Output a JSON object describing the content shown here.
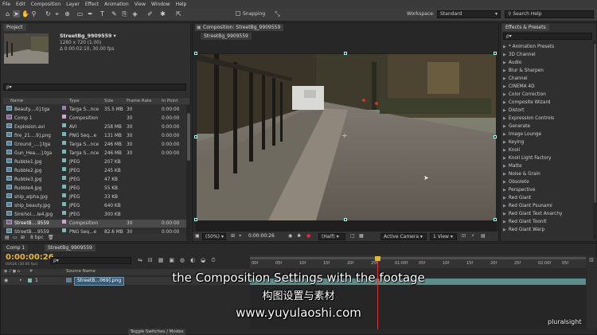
{
  "menu": [
    "File",
    "Edit",
    "Composition",
    "Layer",
    "Effect",
    "Animation",
    "View",
    "Window",
    "Help"
  ],
  "toolbar": {
    "snapping": "Snapping",
    "workspace_label": "Workspace:",
    "workspace_value": "Standard",
    "search_placeholder": "Search Help"
  },
  "project": {
    "tab": "Project",
    "name": "StreetBg_9909559 ▾",
    "line1": "1280 x 720 (1.00)",
    "line2": "Δ 0:00:02:10, 30.00 fps",
    "search": "ρ▾",
    "columns": [
      "Name",
      "Type",
      "Size",
      "Frame Rate",
      "In Point"
    ],
    "rows": [
      {
        "name": "Beauty....0].tga",
        "type": "Targa S...nce",
        "size": "35.5 MB",
        "fps": "30",
        "in": "0:00:00",
        "color": "#9b7fb5",
        "kind": "seq"
      },
      {
        "name": "Comp 1",
        "type": "Composition",
        "size": "",
        "fps": "30",
        "in": "0:00:00",
        "color": "#c9a9c9",
        "kind": "comp"
      },
      {
        "name": "Explosion.avi",
        "type": "AVI",
        "size": "258 MB",
        "fps": "30",
        "in": "0:00:00",
        "color": "#7fb5b5",
        "kind": "avi"
      },
      {
        "name": "fire_21....9].png",
        "type": "PNG Seq...e",
        "size": "131 MB",
        "fps": "30",
        "in": "0:00:00",
        "color": "#7fb5b5",
        "kind": "seq"
      },
      {
        "name": "Ground_....].tga",
        "type": "Targa S...nce",
        "size": "246 MB",
        "fps": "30",
        "in": "0:00:00",
        "color": "#7fb5b5",
        "kind": "seq"
      },
      {
        "name": "Gun_Hea....].tga",
        "type": "Targa S...nce",
        "size": "246 MB",
        "fps": "30",
        "in": "0:00:00",
        "color": "#7fb5b5",
        "kind": "seq"
      },
      {
        "name": "Rubble1.jpg",
        "type": "JPEG",
        "size": "207 KB",
        "fps": "",
        "in": "",
        "color": "#7fb5b5",
        "kind": "img"
      },
      {
        "name": "Rubble2.jpg",
        "type": "JPEG",
        "size": "245 KB",
        "fps": "",
        "in": "",
        "color": "#7fb5b5",
        "kind": "img"
      },
      {
        "name": "Rubble3.jpg",
        "type": "JPEG",
        "size": "47 KB",
        "fps": "",
        "in": "",
        "color": "#7fb5b5",
        "kind": "img"
      },
      {
        "name": "Rubble4.jpg",
        "type": "JPEG",
        "size": "55 KB",
        "fps": "",
        "in": "",
        "color": "#7fb5b5",
        "kind": "img"
      },
      {
        "name": "ship_alpha.jpg",
        "type": "JPEG",
        "size": "33 KB",
        "fps": "",
        "in": "",
        "color": "#7fb5b5",
        "kind": "img"
      },
      {
        "name": "ship_beauty.jpg",
        "type": "JPEG",
        "size": "640 KB",
        "fps": "",
        "in": "",
        "color": "#7fb5b5",
        "kind": "img"
      },
      {
        "name": "Sinkhol....le4.jpg",
        "type": "JPEG",
        "size": "300 KB",
        "fps": "",
        "in": "",
        "color": "#7fb5b5",
        "kind": "img"
      },
      {
        "name": "StreetB....9559",
        "type": "Composition",
        "size": "",
        "fps": "30",
        "in": "0:00:00",
        "color": "#c9a9c9",
        "kind": "comp",
        "selected": true
      },
      {
        "name": "StreetB....9559",
        "type": "PNG Seq...e",
        "size": "82.6 MB",
        "fps": "30",
        "in": "0:00:00",
        "color": "#7fb5b5",
        "kind": "seq"
      }
    ],
    "bpc": "8 bpc"
  },
  "composition": {
    "tab": "Composition: StreetBg_9909559",
    "subtab": "StreetBg_9909559",
    "zoom": "(50%)",
    "timecode": "0:00:00:26",
    "resolution": "(Half)",
    "camera": "Active Camera",
    "view": "1 View"
  },
  "effects": {
    "tab": "Effects & Presets",
    "search": "ρ▾",
    "items": [
      "* Animation Presets",
      "3D Channel",
      "Audio",
      "Blur & Sharpen",
      "Channel",
      "CINEMA 4D",
      "Color Correction",
      "Composite Wizard",
      "Distort",
      "Expression Controls",
      "Generate",
      "Image Lounge",
      "Keying",
      "Knoll",
      "Knoll Light Factory",
      "Matte",
      "Noise & Grain",
      "Obsolete",
      "Perspective",
      "Red Giant",
      "Red Giant Psunami",
      "Red Giant Text Anarchy",
      "Red Giant ToonIt",
      "Red Giant Warp"
    ]
  },
  "timeline": {
    "tabs": [
      "Comp 1",
      "StreetBg_9909559"
    ],
    "timecode": "0:00:00:26",
    "frames": "00026 (30.00 fps)",
    "search": "ρ▾",
    "source_header": "Source Name",
    "layer_index": "1",
    "layer_name": "StreetB...069].png",
    "ruler": [
      "00f",
      "05f",
      "10f",
      "15f",
      "20f",
      "25f",
      "01:00f",
      "05f",
      "10f",
      "15f",
      "20f",
      "25f",
      "02:00f",
      "05f",
      "10f"
    ],
    "toggle": "Toggle Switches / Modes"
  },
  "subtitles": {
    "english": "the Composition Settings with the footage",
    "chinese": "构图设置与素材",
    "url": "www.yuyulaoshi.com"
  },
  "watermark": "pluralsight"
}
